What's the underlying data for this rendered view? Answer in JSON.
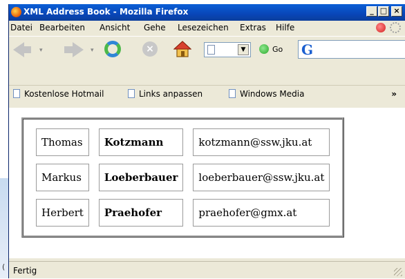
{
  "window": {
    "title": "XML Address Book - Mozilla Firefox",
    "buttons": {
      "minimize": "_",
      "maximize": "□",
      "close": "×"
    }
  },
  "menu": [
    {
      "label": "Datei"
    },
    {
      "label": "Bearbeiten"
    },
    {
      "label": "Ansicht"
    },
    {
      "label": "Gehe"
    },
    {
      "label": "Lesezeichen"
    },
    {
      "label": "Extras"
    },
    {
      "label": "Hilfe"
    }
  ],
  "navbar": {
    "go_label": "Go",
    "back_dropdown": "▾",
    "forward_dropdown": "▾",
    "url_dropdown": "▼"
  },
  "search": {
    "engine_logo": "G"
  },
  "bookmarks": [
    {
      "label": "Kostenlose Hotmail"
    },
    {
      "label": "Links anpassen"
    },
    {
      "label": "Windows Media"
    }
  ],
  "bookmarks_more": "»",
  "address_book": {
    "rows": [
      {
        "first": "Thomas",
        "last": "Kotzmann",
        "email": "kotzmann@ssw.jku.at"
      },
      {
        "first": "Markus",
        "last": "Loeberbauer",
        "email": "loeberbauer@ssw.jku.at"
      },
      {
        "first": "Herbert",
        "last": "Praehofer",
        "email": "praehofer@gmx.at"
      }
    ]
  },
  "status": {
    "text": "Fertig"
  },
  "background": {
    "left_char": "("
  },
  "colors": {
    "titlebar": "#0a5fd6",
    "chrome": "#ece9d8",
    "table_border": "#9a9a9a"
  }
}
